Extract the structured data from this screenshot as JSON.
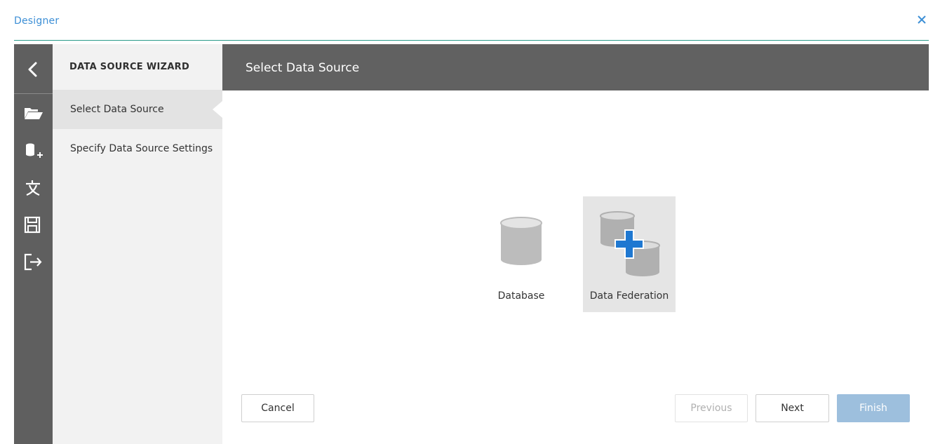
{
  "app": {
    "title": "Designer"
  },
  "rail": {
    "icons": [
      "back-arrow-icon",
      "open-folder-icon",
      "add-database-icon",
      "translate-icon",
      "save-icon",
      "exit-icon"
    ]
  },
  "wizard": {
    "title": "DATA SOURCE WIZARD",
    "steps": [
      {
        "label": "Select Data Source",
        "active": true
      },
      {
        "label": "Specify Data Source Settings",
        "active": false
      }
    ]
  },
  "content": {
    "title": "Select Data Source",
    "sources": [
      {
        "label": "Database",
        "icon": "database-icon",
        "selected": false
      },
      {
        "label": "Data Federation",
        "icon": "data-federation-icon",
        "selected": true
      }
    ]
  },
  "buttons": {
    "cancel": "Cancel",
    "previous": "Previous",
    "next": "Next",
    "finish": "Finish"
  },
  "colors": {
    "accent": "#3d8fd6",
    "rail": "#5f5f5f",
    "header": "#616161",
    "finish_disabled": "#9dbfdd",
    "federation_plus": "#1f78d1"
  }
}
